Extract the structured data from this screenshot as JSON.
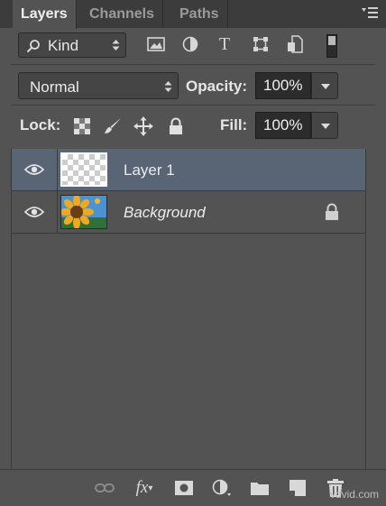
{
  "tabs": [
    {
      "label": "Layers",
      "active": true
    },
    {
      "label": "Channels",
      "active": false
    },
    {
      "label": "Paths",
      "active": false
    }
  ],
  "filter": {
    "kind_label": "Kind",
    "icons": [
      "pixel-layer-filter-icon",
      "adjustment-layer-filter-icon",
      "type-layer-filter-icon",
      "shape-layer-filter-icon",
      "smart-object-filter-icon",
      "filter-toggle-icon"
    ]
  },
  "blend": {
    "mode": "Normal",
    "opacity_label": "Opacity:",
    "opacity_value": "100%"
  },
  "lock": {
    "label": "Lock:",
    "icons": [
      "lock-transparent-pixels-icon",
      "lock-image-pixels-icon",
      "lock-position-icon",
      "lock-all-icon"
    ],
    "fill_label": "Fill:",
    "fill_value": "100%"
  },
  "layers": [
    {
      "name": "Layer 1",
      "selected": true,
      "visible": true,
      "thumbnail": "transparent",
      "locked": false
    },
    {
      "name": "Background",
      "selected": false,
      "visible": true,
      "thumbnail": "sunflower-photo",
      "locked": true
    }
  ],
  "bottom_icons": [
    "link-layers-icon",
    "fx-icon",
    "add-mask-icon",
    "adjustment-layer-icon",
    "new-group-icon",
    "new-layer-icon",
    "trash-icon"
  ],
  "watermark": "vdvid.com",
  "colors": {
    "panel_bg": "#535353",
    "selected_row": "#596575",
    "tab_bar": "#3c3c3c"
  }
}
